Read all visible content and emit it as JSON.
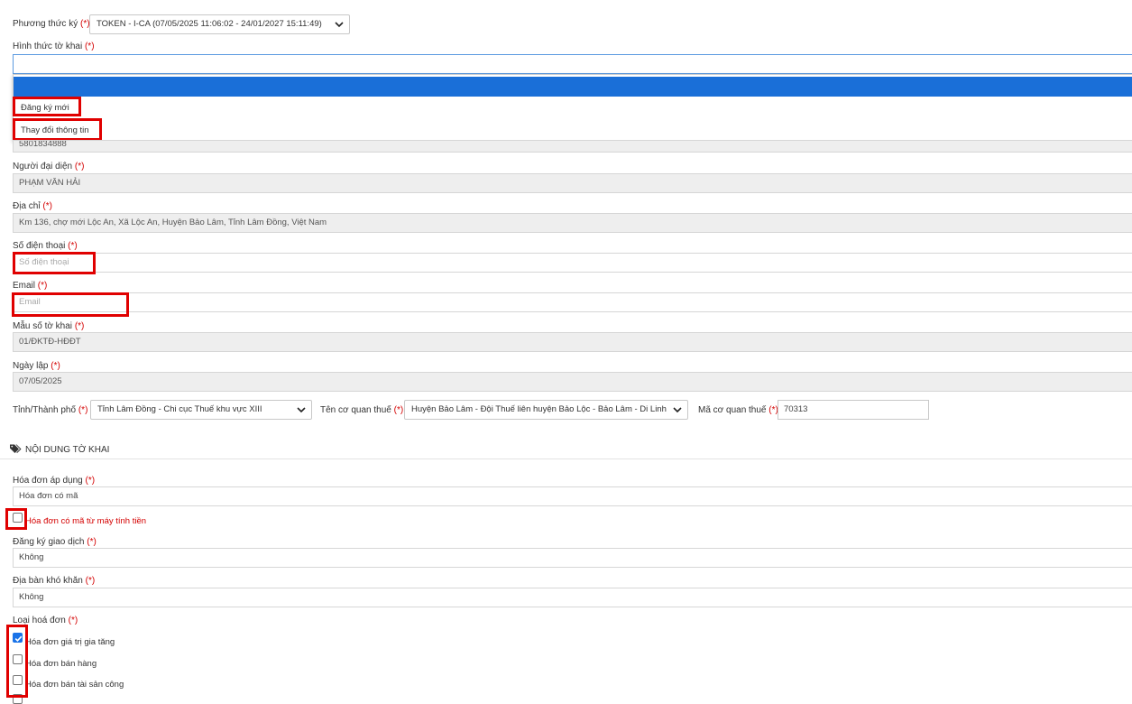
{
  "signing": {
    "label": "Phương thức ký",
    "required_mark": "(*)",
    "selected": "TOKEN - I-CA (07/05/2025 11:06:02 - 24/01/2027 15:11:49)"
  },
  "form_type": {
    "label": "Hình thức tờ khai",
    "required_mark": "(*)",
    "value": "",
    "options": [
      "Đăng ký mới",
      "Thay đổi thông tin"
    ]
  },
  "tax_code": {
    "value": "5801834888"
  },
  "representative": {
    "label": "Người đại diện",
    "required_mark": "(*)",
    "value": "PHẠM VĂN HẢI"
  },
  "address": {
    "label": "Địa chỉ",
    "required_mark": "(*)",
    "value": "Km 136, chợ mới Lộc An, Xã Lộc An, Huyện Bảo Lâm, Tỉnh Lâm Đồng, Việt Nam"
  },
  "phone": {
    "label": "Số điện thoại",
    "required_mark": "(*)",
    "value": "",
    "placeholder": "Số điện thoại"
  },
  "email": {
    "label": "Email",
    "required_mark": "(*)",
    "value": "",
    "placeholder": "Email"
  },
  "form_number": {
    "label": "Mẫu số tờ khai",
    "required_mark": "(*)",
    "value": "01/ĐKTĐ-HĐĐT"
  },
  "created_date": {
    "label": "Ngày lập",
    "required_mark": "(*)",
    "value": "07/05/2025"
  },
  "province": {
    "label": "Tỉnh/Thành phố",
    "required_mark": "(*)",
    "selected": "Tỉnh Lâm Đồng - Chi cục Thuế khu vực XIII"
  },
  "tax_office": {
    "label": "Tên cơ quan thuế",
    "required_mark": "(*)",
    "selected": "Huyện Bảo Lâm - Đội Thuế liên huyện Bảo Lộc - Bảo Lâm - Di Linh"
  },
  "tax_office_code": {
    "label": "Mã cơ quan thuế",
    "required_mark": "(*)",
    "value": "70313"
  },
  "section": {
    "title": "NỘI DUNG TỜ KHAI",
    "icon": "tags-icon"
  },
  "invoice_applied": {
    "label": "Hóa đơn áp dụng",
    "required_mark": "(*)",
    "value": "Hóa đơn có mã"
  },
  "cash_register": {
    "label": "Hóa đơn có mã từ máy tính tiền",
    "checked": false
  },
  "transaction_reg": {
    "label": "Đăng ký giao dịch",
    "required_mark": "(*)",
    "value": "Không"
  },
  "difficult_area": {
    "label": "Địa bàn khó khăn",
    "required_mark": "(*)",
    "value": "Không"
  },
  "invoice_types": {
    "label": "Loại hoá đơn",
    "required_mark": "(*)",
    "items": [
      {
        "label": "Hóa đơn giá trị gia tăng",
        "checked": true
      },
      {
        "label": "Hóa đơn bán hàng",
        "checked": false
      },
      {
        "label": "Hóa đơn bán tài sản công",
        "checked": false
      }
    ]
  },
  "colors": {
    "accent": "#1a6fd8",
    "highlight": "#e00000",
    "required": "#d40000"
  }
}
